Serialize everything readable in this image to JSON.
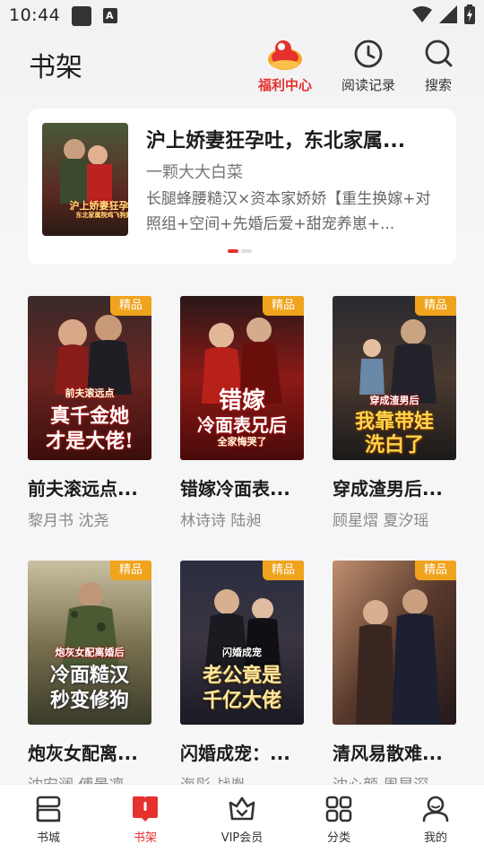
{
  "status": {
    "time": "10:44",
    "app_badge": "A"
  },
  "header": {
    "title": "书架",
    "welfare_label": "福利中心",
    "history_label": "阅读记录",
    "search_label": "搜索"
  },
  "featured": {
    "title": "沪上娇妻狂孕吐，东北家属...",
    "author": "一颗大大白菜",
    "description": "长腿蜂腰糙汉×资本家娇娇【重生换嫁+对照组+空间+先婚后爱+甜宠养崽+...",
    "cover_text_1": "沪上娇妻狂孕吐",
    "cover_text_2": "东北家属院鸡飞狗跳"
  },
  "badge_label": "精品",
  "books": [
    {
      "title": "前夫滚远点...",
      "authors": "黎月书  沈尧",
      "cover_line1": "真千金她",
      "cover_line2": "才是大佬!",
      "cover_top": "前夫滚远点"
    },
    {
      "title": "错嫁冷面表...",
      "authors": "林诗诗  陆昶",
      "cover_line1": "错嫁",
      "cover_line2": "冷面表兄后",
      "cover_top": "全家悔哭了"
    },
    {
      "title": "穿成渣男后...",
      "authors": "顾星熠  夏汐瑶",
      "cover_line1": "我靠带娃",
      "cover_line2": "洗白了",
      "cover_top": "穿成渣男后"
    },
    {
      "title": "炮灰女配离...",
      "authors": "沈安澜  傅景凛",
      "cover_line1": "冷面糙汉",
      "cover_line2": "秒变修狗",
      "cover_top": "炮灰女配离婚后"
    },
    {
      "title": "闪婚成宠：...",
      "authors": "海彤  战胤",
      "cover_line1": "老公竟是",
      "cover_line2": "千亿大佬",
      "cover_top": "闪婚成宠"
    },
    {
      "title": "清风易散难...",
      "authors": "沈心颜  周昱深",
      "cover_line1": "",
      "cover_line2": "",
      "cover_top": ""
    }
  ],
  "nav": [
    {
      "label": "书城",
      "icon": "book-store-icon"
    },
    {
      "label": "书架",
      "icon": "bookshelf-icon"
    },
    {
      "label": "VIP会员",
      "icon": "vip-crown-icon"
    },
    {
      "label": "分类",
      "icon": "category-grid-icon"
    },
    {
      "label": "我的",
      "icon": "profile-icon"
    }
  ],
  "colors": {
    "accent": "#e5322e",
    "badge": "#f0a31c"
  }
}
